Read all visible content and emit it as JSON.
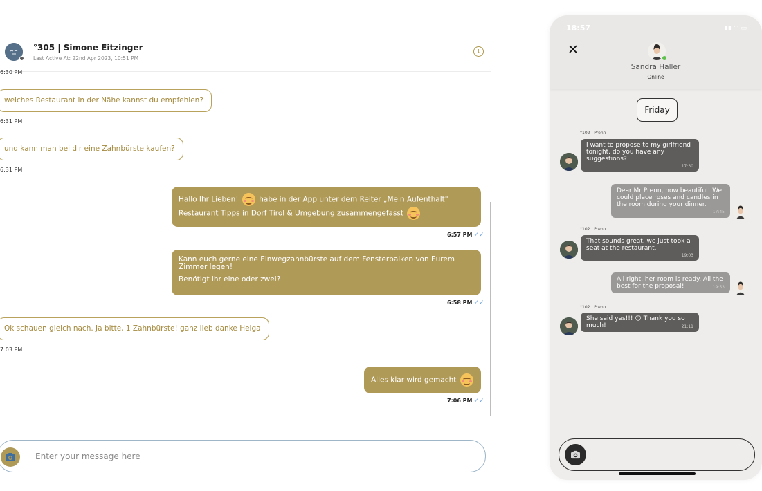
{
  "desktop": {
    "header": {
      "title": "°305 | Simone Eitzinger",
      "last_active": "Last Active At: 22nd Apr 2023, 10:51 PM",
      "info_icon": "info-icon"
    },
    "messages": {
      "ts_top": "6:30 PM",
      "in_1": "welches Restaurant in der Nähe kannst du empfehlen?",
      "in_1_time": "6:31 PM",
      "in_2": "und kann man bei dir eine Zahnbürste kaufen?",
      "in_2_time": "6:31 PM",
      "out_1_line1_a": "Hallo Ihr Lieben!",
      "out_1_line1_b": "habe in der App unter dem Reiter „Mein Aufenthalt\"",
      "out_1_line2": "Restaurant Tipps in Dorf Tirol & Umgebung zusammengefasst",
      "out_1_time": "6:57 PM",
      "out_2_line1": "Kann euch gerne eine Einwegzahnbürste auf dem Fensterbalken von Eurem",
      "out_2_line2": "Zimmer legen!",
      "out_2_line3": "Benötigt ihr eine oder zwei?",
      "out_2_time": "6:58 PM",
      "in_3": "Ok schauen gleich nach. Ja bitte, 1 Zahnbürste! ganz lieb danke Helga",
      "in_3_time": "7:03 PM",
      "out_3": "Alles klar wird gemacht",
      "out_3_time": "7:06 PM",
      "read_ticks": "✓✓"
    },
    "composer": {
      "placeholder": "Enter your message here",
      "camera_icon": "camera-icon"
    },
    "colors": {
      "accent": "#b09a58",
      "outline": "#b9a35c",
      "tick": "#6fa3e0"
    }
  },
  "phone": {
    "status_time": "18:57",
    "close": "✕",
    "contact_name": "Sandra Haller",
    "contact_status": "Online",
    "day": "Friday",
    "messages": [
      {
        "sender": "°102 | Prenn",
        "l1": "I want to propose to my girlfriend",
        "l2": "tonight, do you have any",
        "l3": "suggestions?",
        "time": "17:30"
      },
      {
        "l1": "Dear Mr Prenn, how beautiful! We",
        "l2": "could place roses and candles in",
        "l3": "the room during your dinner.",
        "time": "17:45"
      },
      {
        "sender": "°102 | Prenn",
        "l1": "That sounds great, we just took a",
        "l2": "seat at the restaurant.",
        "time": "19:03"
      },
      {
        "l1": "All right, her room is ready. All the",
        "l2": "best for the proposal!",
        "time": "19:53"
      },
      {
        "sender": "°102 | Prenn",
        "l1": "She said yes!!! 😍 Thank you so",
        "l2": "much!",
        "time": "21:11"
      }
    ],
    "colors": {
      "incoming": "#5f5d5b",
      "outgoing": "#9b9997",
      "online_dot": "#5ec24a"
    }
  }
}
